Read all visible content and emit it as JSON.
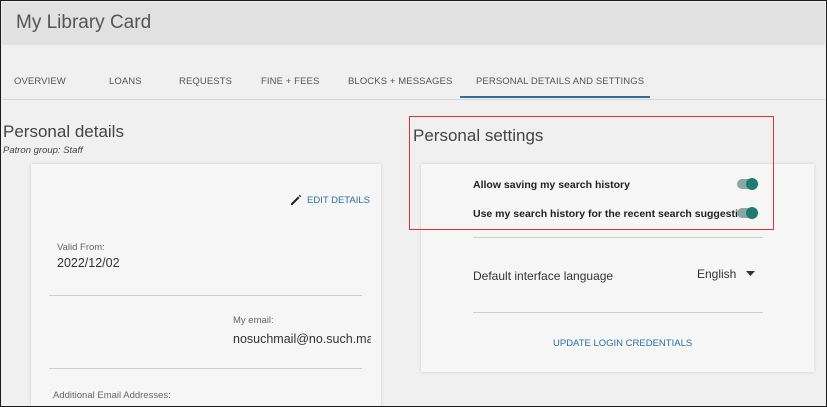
{
  "header": {
    "title": "My Library Card"
  },
  "tabs": [
    {
      "label": "OVERVIEW"
    },
    {
      "label": "LOANS"
    },
    {
      "label": "REQUESTS"
    },
    {
      "label": "FINE + FEES"
    },
    {
      "label": "BLOCKS + MESSAGES"
    },
    {
      "label": "PERSONAL DETAILS AND SETTINGS",
      "active": true
    }
  ],
  "personal_details": {
    "title": "Personal details",
    "patron_group": "Patron group: Staff",
    "edit_label": "EDIT DETAILS",
    "valid_from_label": "Valid From:",
    "valid_from_value": "2022/12/02",
    "email_label": "My email:",
    "email_value": "nosuchmail@no.such.mail.c",
    "additional_email_label": "Additional Email Addresses:"
  },
  "personal_settings": {
    "title": "Personal settings",
    "toggles": [
      {
        "label": "Allow saving my search history",
        "on": true
      },
      {
        "label": "Use my search history for the recent search suggestions",
        "on": true
      }
    ],
    "language_label": "Default interface language",
    "language_value": "English",
    "update_label": "UPDATE LOGIN CREDENTIALS"
  },
  "colors": {
    "accent": "#2d6ea3",
    "toggle_on": "#1f7a6f",
    "highlight": "#e0303a"
  },
  "icons": {
    "edit": "pencil-icon",
    "dropdown": "caret-down-icon"
  }
}
